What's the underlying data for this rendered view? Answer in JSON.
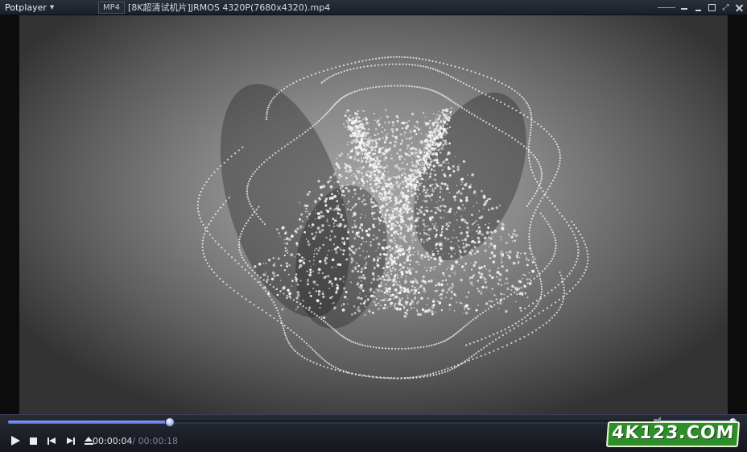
{
  "titlebar": {
    "app_name": "Potplayer",
    "format_badge": "MP4",
    "file_title": "[8K超清试机片]JRMOS 4320P(7680x4320).mp4"
  },
  "playback": {
    "current_time": "00:00:04",
    "separator": "/",
    "total_time": "00:00:18",
    "progress_fraction": 0.2222,
    "volume_fraction": 1.0
  },
  "watermark": {
    "text": "4K123.COM"
  },
  "colors": {
    "seek_fill": "#6b84f0",
    "watermark_bg": "#2e8f2a"
  },
  "icons": [
    "play-icon",
    "stop-icon",
    "prev-icon",
    "next-icon",
    "eject-icon",
    "volume-icon",
    "minimize-icon",
    "maximize-icon",
    "fullscreen-icon",
    "close-icon"
  ]
}
